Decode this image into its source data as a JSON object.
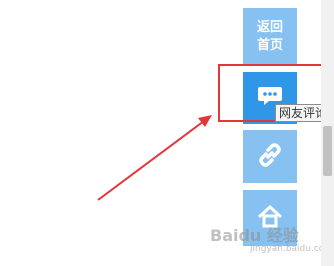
{
  "sidebar": {
    "home_line1": "返回",
    "home_line2": "首页",
    "comment_icon": "comment-bubble-icon",
    "link_icon": "link-icon",
    "share_icon": "share-icon"
  },
  "tooltip": {
    "text": "网友评论"
  },
  "watermark": {
    "brand": "Baidu",
    "suffix": "经验",
    "url": "jingyan.baidu.com"
  },
  "colors": {
    "button": "#87c1f1",
    "button_active": "#2f96e8",
    "highlight": "#e2363b",
    "arrow": "#e2363b"
  }
}
